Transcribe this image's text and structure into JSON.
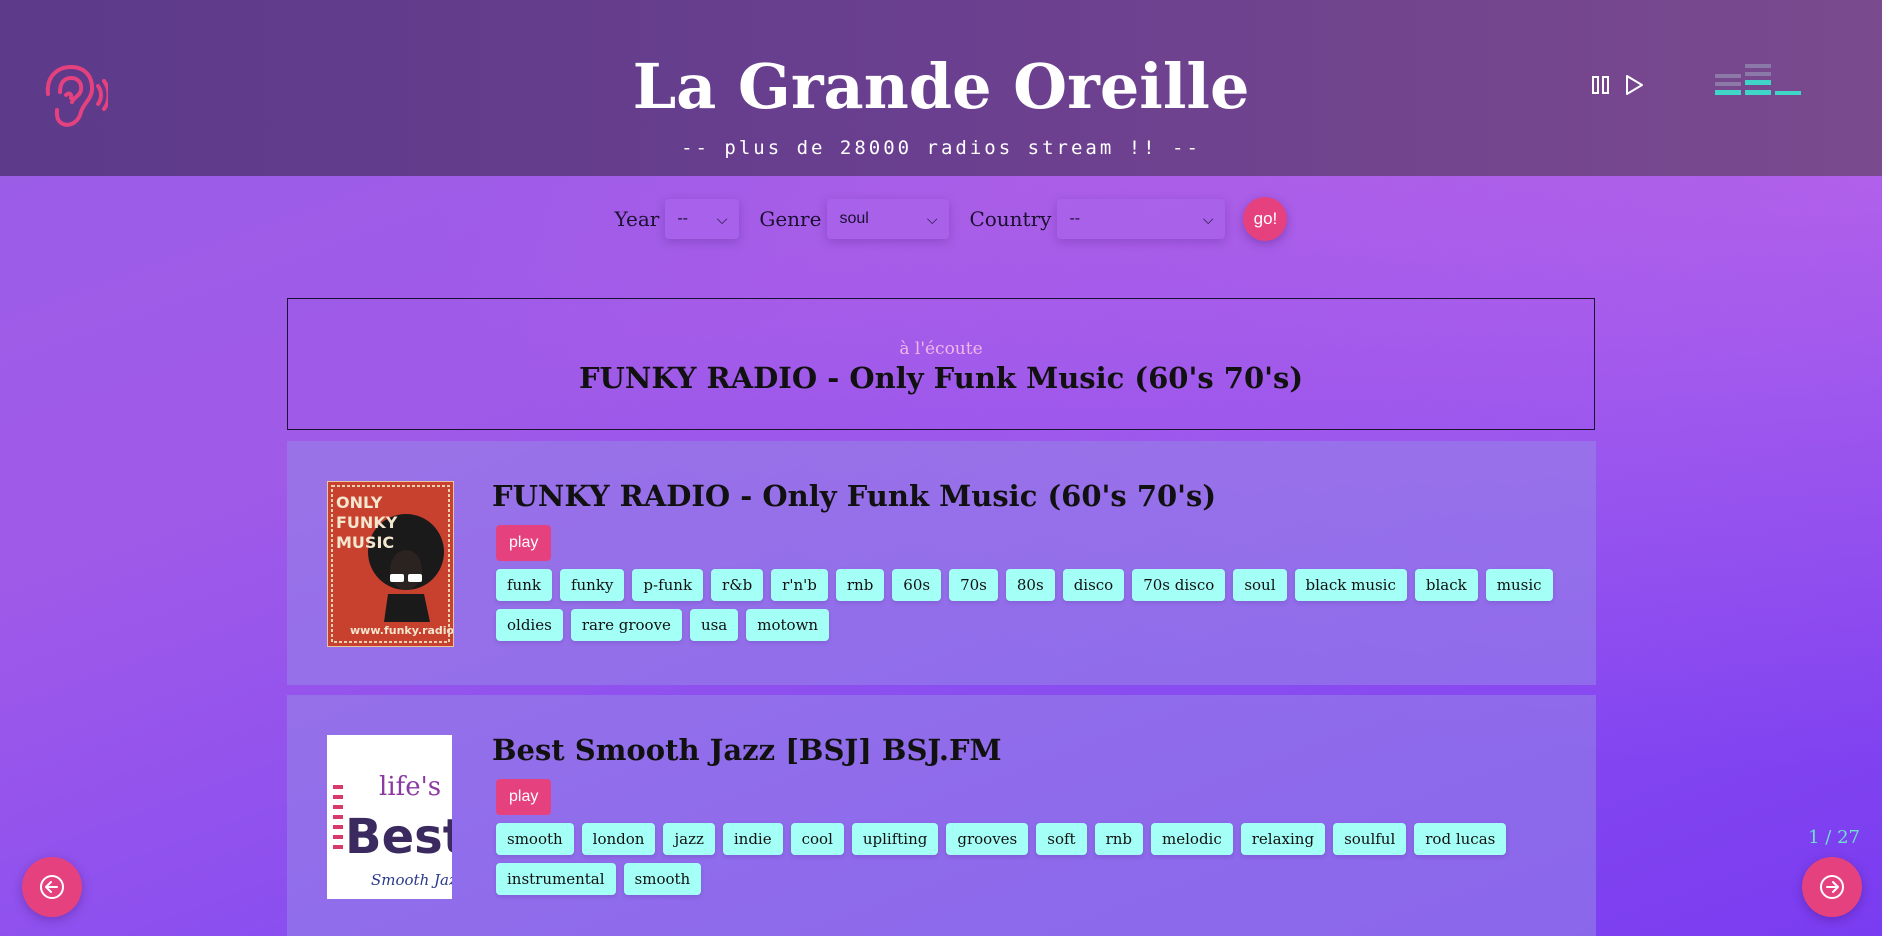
{
  "header": {
    "title": "La Grande Oreille",
    "subtitle": "-- plus de 28000 radios stream !! --",
    "logo_icon": "ear-icon",
    "controls": [
      "pause-icon",
      "play-icon"
    ],
    "equalizer_icon": "equalizer-icon"
  },
  "filters": {
    "year_label": "Year",
    "year_value": "--",
    "genre_label": "Genre",
    "genre_value": "soul",
    "country_label": "Country",
    "country_value": "--",
    "go_label": "go!"
  },
  "now_playing": {
    "label": "à l'écoute",
    "title": "FUNKY RADIO - Only Funk Music (60's 70's)"
  },
  "stations": [
    {
      "title": "FUNKY RADIO - Only Funk Music (60's 70's)",
      "play_label": "play",
      "thumb_text": [
        "ONLY",
        "FUNKY",
        "MUSIC",
        "www.funky.radio"
      ],
      "tags": [
        "funk",
        "funky",
        "p-funk",
        "r&b",
        "r'n'b",
        "rnb",
        "60s",
        "70s",
        "80s",
        "disco",
        "70s disco",
        "soul",
        "black music",
        "black",
        "music",
        "oldies",
        "rare groove",
        "usa",
        "motown"
      ]
    },
    {
      "title": "Best Smooth Jazz [BSJ] BSJ.FM",
      "play_label": "play",
      "thumb_text": [
        "life's",
        "Best",
        "Smooth Jazz"
      ],
      "tags": [
        "smooth",
        "london",
        "jazz",
        "indie",
        "cool",
        "uplifting",
        "grooves",
        "soft",
        "rnb",
        "melodic",
        "relaxing",
        "soulful",
        "rod lucas",
        "instrumental",
        "smooth"
      ]
    }
  ],
  "pager": {
    "text": "1 / 27"
  },
  "colors": {
    "accent": "#e5417f",
    "tag_bg": "#a4fff6",
    "header_bg": "#63408c",
    "equalizer": "#3fd6c8"
  }
}
